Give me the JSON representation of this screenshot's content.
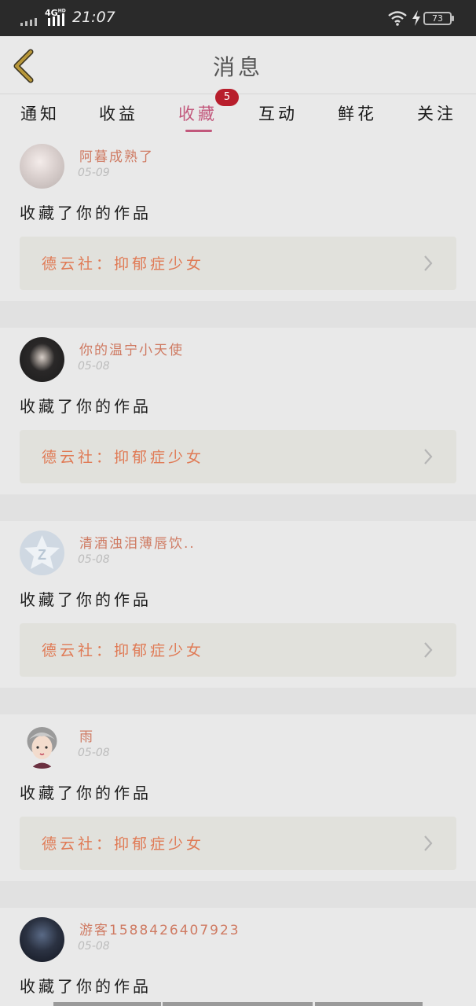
{
  "status_bar": {
    "network": "4G",
    "network_sup": "HD",
    "time": "21:07",
    "battery": "73",
    "icons": [
      "signal-icon",
      "wifi-icon",
      "charging-icon",
      "battery-icon"
    ]
  },
  "header": {
    "title": "消息",
    "back_icon": "chevron-left-icon"
  },
  "tabs": [
    {
      "label": "通知"
    },
    {
      "label": "收益"
    },
    {
      "label": "收藏",
      "badge": "5"
    },
    {
      "label": "互动"
    },
    {
      "label": "鲜花"
    },
    {
      "label": "关注"
    }
  ],
  "active_tab": "收藏",
  "notifications": [
    {
      "username": "阿暮成熟了",
      "date": "05-09",
      "action": "收藏了你的作品",
      "work_title": "德云社：抑郁症少女"
    },
    {
      "username": "你的温宁小天使",
      "date": "05-08",
      "action": "收藏了你的作品",
      "work_title": "德云社：抑郁症少女"
    },
    {
      "username": "清酒浊泪薄唇饮..",
      "date": "05-08",
      "action": "收藏了你的作品",
      "work_title": "德云社：抑郁症少女"
    },
    {
      "username": "雨",
      "date": "05-08",
      "action": "收藏了你的作品",
      "work_title": "德云社：抑郁症少女"
    },
    {
      "username": "游客1588426407923",
      "date": "05-08",
      "action": "收藏了你的作品",
      "work_title": ""
    }
  ],
  "colors": {
    "accent": "#c2587c",
    "badge": "#b81e2c",
    "username": "#cf7a62",
    "work_title": "#e07a55",
    "back_arrow": "#b8973a"
  }
}
